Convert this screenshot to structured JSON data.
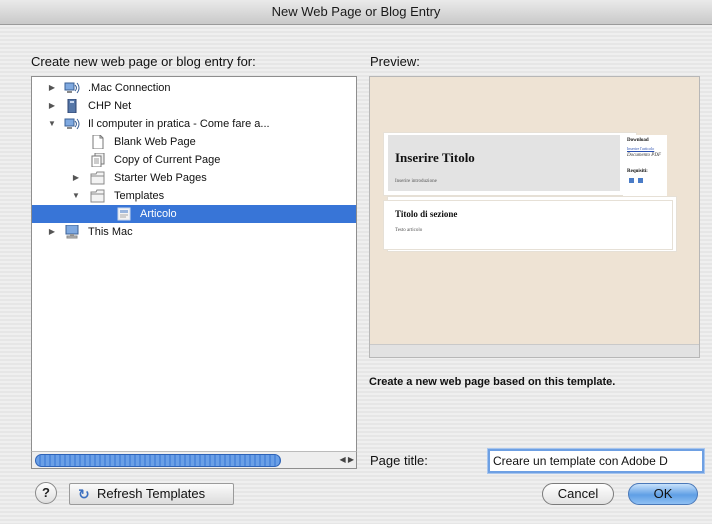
{
  "window": {
    "title": "New Web Page or Blog Entry"
  },
  "left": {
    "label": "Create new web page or blog entry for:",
    "tree": [
      {
        "label": ".Mac Connection",
        "icon": "network-icon",
        "disclosure": "collapsed"
      },
      {
        "label": "CHP Net",
        "icon": "server-icon",
        "disclosure": "collapsed"
      },
      {
        "label": "Il computer in pratica - Come fare a...",
        "icon": "network-icon",
        "disclosure": "expanded"
      },
      {
        "label": "Blank Web Page",
        "icon": "blank-page-icon",
        "disclosure": "none"
      },
      {
        "label": "Copy of Current Page",
        "icon": "copy-page-icon",
        "disclosure": "none"
      },
      {
        "label": "Starter Web Pages",
        "icon": "folder-icon",
        "disclosure": "collapsed"
      },
      {
        "label": "Templates",
        "icon": "folder-icon",
        "disclosure": "expanded"
      },
      {
        "label": "Articolo",
        "icon": "template-icon",
        "disclosure": "none",
        "selected": true
      },
      {
        "label": "This Mac",
        "icon": "computer-icon",
        "disclosure": "collapsed"
      }
    ]
  },
  "preview": {
    "label": "Preview:",
    "page_title": "Inserire Titolo",
    "intro": "Inserire introduzione",
    "sidebar_download": "Download",
    "sidebar_link": "Inserire l'articolo",
    "sidebar_pdf": "Documento PDF",
    "sidebar_requirements": "Requisiti:",
    "section_title": "Titolo di sezione",
    "section_text": "Testo articolo",
    "description": "Create a new web page based on this template."
  },
  "form": {
    "page_title_label": "Page title:",
    "page_title_value": "Creare un template con Adobe D"
  },
  "buttons": {
    "help": "?",
    "refresh": "Refresh Templates",
    "cancel": "Cancel",
    "ok": "OK"
  },
  "colors": {
    "selection": "#3875d7",
    "preview_bg": "#eee3d4",
    "default_button": "#5f9fe5"
  }
}
